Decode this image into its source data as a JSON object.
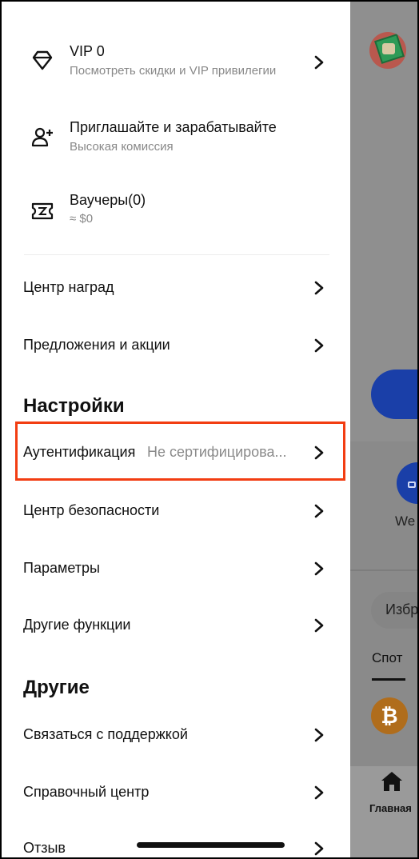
{
  "promos": [
    {
      "title": "VIP 0",
      "subtitle": "Посмотреть скидки и VIP привилегии",
      "icon": "diamond-icon"
    },
    {
      "title": "Приглашайте и зарабатывайте",
      "subtitle": "Высокая комиссия",
      "icon": "add-user-icon"
    },
    {
      "title": "Ваучеры(0)",
      "subtitle": "≈ $0",
      "icon": "voucher-icon"
    }
  ],
  "menu": {
    "rewards": "Центр наград",
    "offers": "Предложения и акции"
  },
  "settings": {
    "title": "Настройки",
    "auth_label": "Аутентификация",
    "auth_value": "Не сертифицирова...",
    "security": "Центр безопасности",
    "params": "Параметры",
    "other_features": "Другие функции"
  },
  "others": {
    "title": "Другие",
    "support": "Связаться с поддержкой",
    "help": "Справочный центр",
    "feedback": "Отзыв"
  },
  "background": {
    "we_text": "We",
    "favorites_text": "Избр",
    "spot_tab": "Спот",
    "btc_symbol": "₿",
    "home_label": "Главная"
  },
  "colors": {
    "highlight": "#f23d12",
    "accent_blue": "#1a3fa8",
    "btc_orange": "#b06d1c"
  }
}
